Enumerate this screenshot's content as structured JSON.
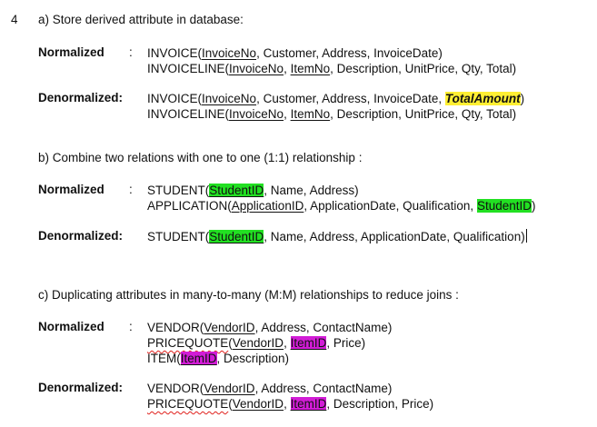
{
  "page_number": "4",
  "section_a": {
    "header": "a)  Store derived attribute in database:",
    "normalized": {
      "label": "Normalized",
      "colon": ":",
      "invoice": {
        "prefix": "INVOICE(",
        "key": "InvoiceNo",
        "rest": ", Customer, Address,  InvoiceDate)"
      },
      "invoiceline": {
        "prefix": "INVOICELINE(",
        "key1": "InvoiceNo",
        "sep": ", ",
        "key2": "ItemNo",
        "rest": ", Description, UnitPrice, Qty, Total)"
      }
    },
    "denormalized": {
      "label": "Denormalized:",
      "invoice": {
        "prefix": "INVOICE(",
        "key": "InvoiceNo",
        "mid": ", Customer, Address,  InvoiceDate, ",
        "highlight": "TotalAmount",
        "end": ")"
      },
      "invoiceline": {
        "prefix": "INVOICELINE(",
        "key1": "InvoiceNo",
        "sep": ", ",
        "key2": "ItemNo",
        "rest": ", Description, UnitPrice, Qty, Total)"
      }
    }
  },
  "section_b": {
    "header": "b)   Combine two relations with one to one (1:1) relationship :",
    "normalized": {
      "label": "Normalized",
      "colon": ":",
      "student": {
        "prefix": "STUDENT(",
        "key": "StudentID",
        "rest": ", Name, Address)"
      },
      "application": {
        "prefix": "APPLICATION(",
        "key": "ApplicationID",
        "mid": ", ApplicationDate, Qualification, ",
        "fk": "StudentID",
        "end": ")"
      }
    },
    "denormalized": {
      "label": "Denormalized:",
      "student": {
        "prefix": "STUDENT(",
        "key": "StudentID",
        "rest": ", Name, Address, ApplicationDate, Qualification)"
      }
    }
  },
  "section_c": {
    "header": "c)  Duplicating attributes in many-to-many (M:M) relationships to reduce joins :",
    "normalized": {
      "label": "Normalized",
      "colon": ":",
      "vendor": {
        "prefix": "VENDOR(",
        "key": "VendorID",
        "rest": ", Address, ContactName)"
      },
      "pricequote": {
        "name": "PRICEQUOTE",
        "paren": "(",
        "key1": "VendorID",
        "sep": ", ",
        "key2": "ItemID",
        "rest": ", Price)"
      },
      "item": {
        "prefix": "ITEM(",
        "key": "ItemID",
        "rest": ", Description)"
      }
    },
    "denormalized": {
      "label": "Denormalized:",
      "vendor": {
        "prefix": "VENDOR(",
        "key": "VendorID",
        "rest": ", Address, ContactName)"
      },
      "pricequote": {
        "name": "PRICEQUOTE",
        "paren": "(",
        "key1": "VendorID",
        "sep": ", ",
        "key2": "ItemID",
        "rest": ", Description, Price)"
      }
    }
  },
  "colors": {
    "green_highlight": "#22e022",
    "yellow_highlight": "#ffef33",
    "magenta_highlight": "#d21cd6",
    "spellcheck": "#e0201c"
  }
}
